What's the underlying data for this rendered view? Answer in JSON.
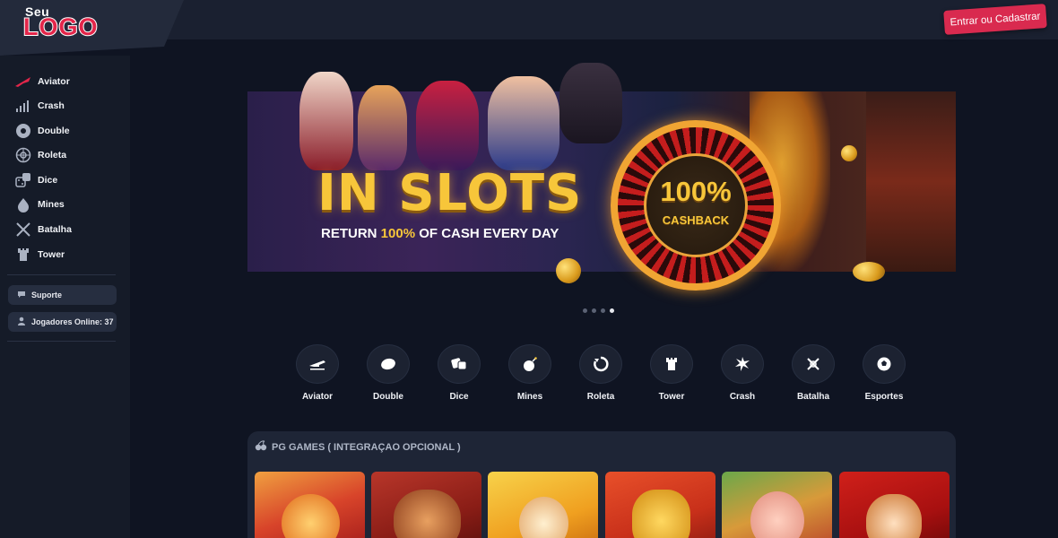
{
  "header": {
    "logo_small": "Seu",
    "logo_big": "LOGO",
    "login_label": "Entrar ou Cadastrar"
  },
  "sidebar": {
    "items": [
      {
        "label": "Aviator",
        "icon": "plane-icon"
      },
      {
        "label": "Crash",
        "icon": "bar-chart-icon"
      },
      {
        "label": "Double",
        "icon": "disc-icon"
      },
      {
        "label": "Roleta",
        "icon": "roulette-icon"
      },
      {
        "label": "Dice",
        "icon": "dice-icon"
      },
      {
        "label": "Mines",
        "icon": "bomb-icon"
      },
      {
        "label": "Batalha",
        "icon": "swords-icon"
      },
      {
        "label": "Tower",
        "icon": "tower-icon"
      }
    ],
    "support_label": "Suporte",
    "online_label": "Jogadores Online: 37"
  },
  "banner": {
    "headline": "IN SLOTS",
    "sub_prefix": "RETURN ",
    "sub_highlight": "100%",
    "sub_suffix": " OF CASH EVERY DAY",
    "cashback_value": "100%",
    "cashback_label": "CASHBACK",
    "slide_count": 4,
    "active_slide": 4
  },
  "quick_games": [
    {
      "label": "Aviator",
      "icon": "plane-icon"
    },
    {
      "label": "Double",
      "icon": "disc-icon"
    },
    {
      "label": "Dice",
      "icon": "dice-icon"
    },
    {
      "label": "Mines",
      "icon": "bomb-icon"
    },
    {
      "label": "Roleta",
      "icon": "roulette-icon"
    },
    {
      "label": "Tower",
      "icon": "tower-icon"
    },
    {
      "label": "Crash",
      "icon": "crash-icon"
    },
    {
      "label": "Batalha",
      "icon": "swords-icon"
    },
    {
      "label": "Esportes",
      "icon": "soccer-ball-icon"
    }
  ],
  "pg_games": {
    "title": "PG GAMES ( INTEGRAÇAO OPCIONAL )",
    "cards": [
      {
        "name": "fortune-tiger"
      },
      {
        "name": "fortune-ox"
      },
      {
        "name": "fortune-mouse"
      },
      {
        "name": "fortune-dragon"
      },
      {
        "name": "piggy-gold"
      },
      {
        "name": "caishen-wins"
      }
    ]
  },
  "colors": {
    "brand": "#d92a4f",
    "background": "#0f1422",
    "sidebar": "#151b28",
    "panel": "#1e2536",
    "gold": "#f7c63a"
  }
}
